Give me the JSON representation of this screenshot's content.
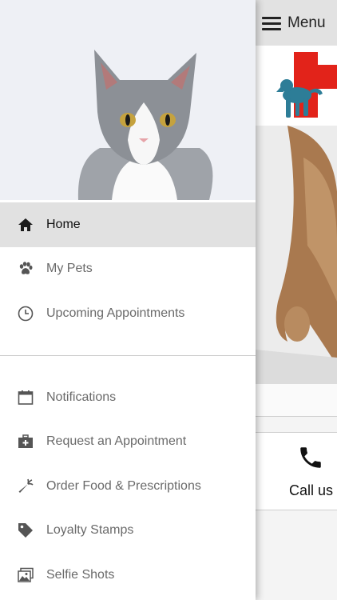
{
  "app": {
    "menu_label": "Menu",
    "call_label": "Call us"
  },
  "drawer": {
    "items_primary": [
      {
        "label": "Home",
        "icon": "home-icon",
        "active": true
      },
      {
        "label": "My Pets",
        "icon": "paw-icon"
      },
      {
        "label": "Upcoming Appointments",
        "icon": "clock-icon"
      }
    ],
    "items_secondary": [
      {
        "label": "Notifications",
        "icon": "calendar-icon"
      },
      {
        "label": "Request an Appointment",
        "icon": "medical-kit-icon"
      },
      {
        "label": "Order Food & Prescriptions",
        "icon": "carrot-icon"
      },
      {
        "label": "Loyalty Stamps",
        "icon": "tag-icon"
      },
      {
        "label": "Selfie Shots",
        "icon": "images-icon"
      }
    ]
  },
  "colors": {
    "brand_red": "#e2231a",
    "brand_teal": "#2d7d97",
    "active_bg": "#e1e1e1",
    "icon_gray": "#555555"
  }
}
